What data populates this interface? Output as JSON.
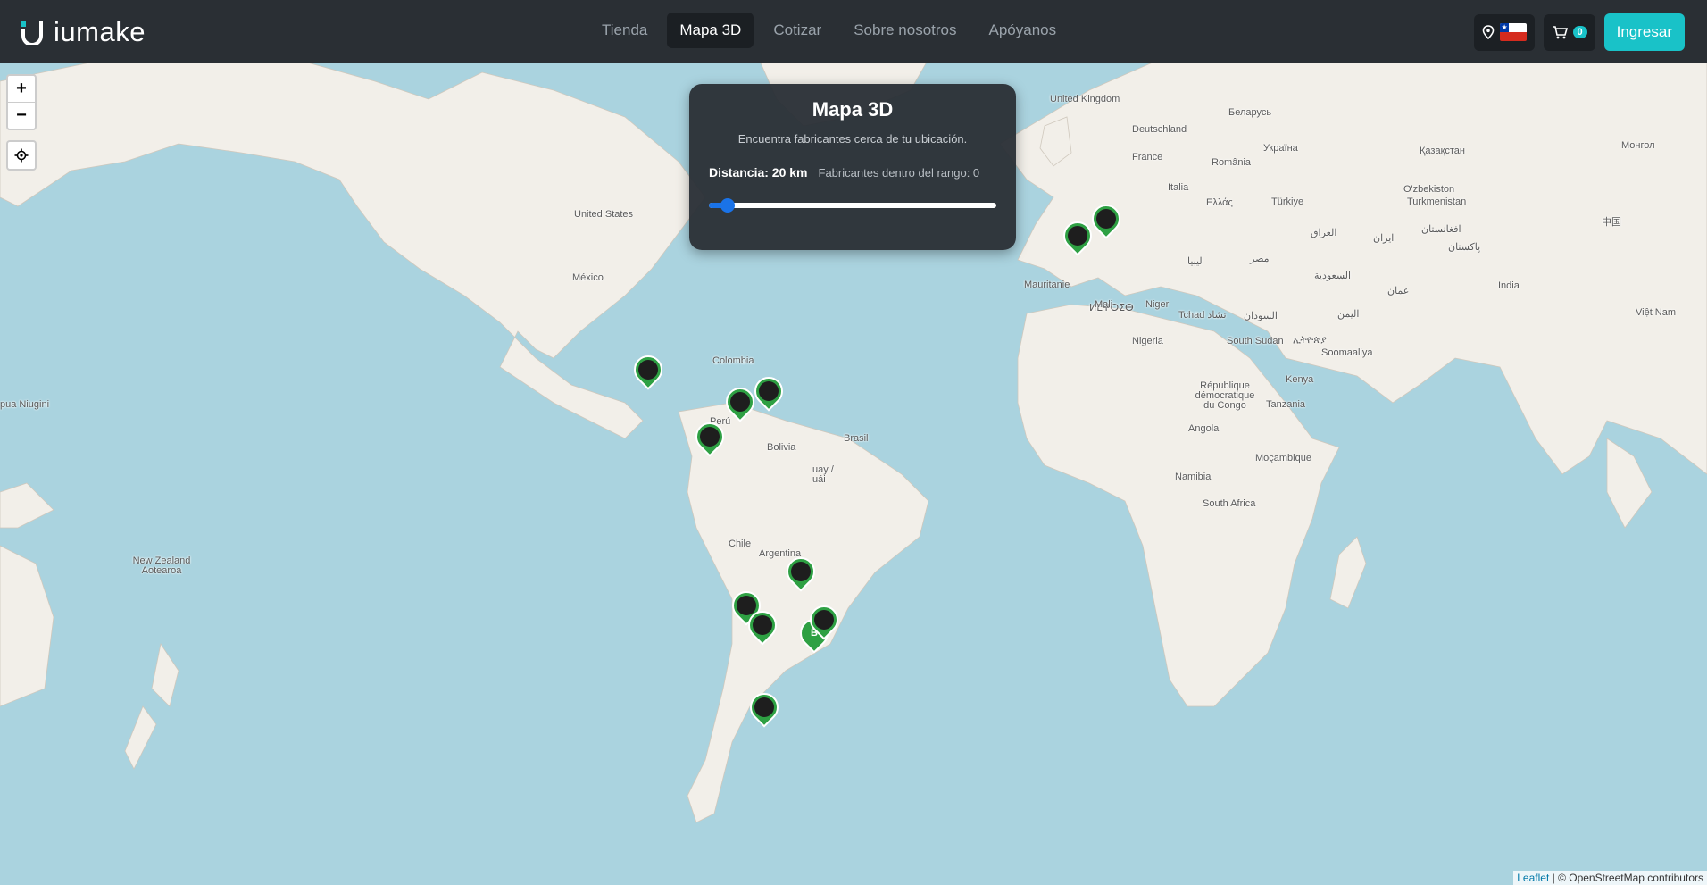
{
  "header": {
    "logo_text": "iumake",
    "nav": [
      "Tienda",
      "Mapa 3D",
      "Cotizar",
      "Sobre nosotros",
      "Apóyanos"
    ],
    "active_nav": "Mapa 3D",
    "cart_count": "0",
    "login_label": "Ingresar",
    "icons": {
      "location": "location-pin-icon",
      "flag": "chile-flag-icon",
      "cart": "cart-icon"
    },
    "brand_color": "#19c2c8"
  },
  "zoom": {
    "in": "+",
    "out": "−"
  },
  "panel": {
    "title": "Mapa 3D",
    "subtitle": "Encuentra fabricantes cerca de tu ubicación.",
    "distance_label": "Distancia: 20 km",
    "range_text": "Fabricantes dentro del rango: 0",
    "slider_fraction": 0.03
  },
  "map_labels": {
    "united_kingdom": "United Kingdom",
    "belarus": "Беларусь",
    "deutschland": "Deutschland",
    "ukraina": "Україна",
    "kazakhstan": "Қазақстан",
    "mongolia": "Монгол",
    "france": "France",
    "romania": "România",
    "italia": "Italia",
    "uzbekistan": "O'zbekiston",
    "ellas": "Ελλάς",
    "turkiye": "Türkiye",
    "turkmenistan": "Turkmenistan",
    "china": "中国",
    "iraq": "العراق",
    "iran": "ایران",
    "afghanistan": "افغانستان",
    "pakistan": "پاکستان",
    "united_states": "United States",
    "morocco": "ⵍⵎⵖⵔⵉⴱ",
    "libya": "ليبيا",
    "egypt": "مصر",
    "saudi": "السعودية",
    "oman": "عمان",
    "india": "India",
    "mexico": "México",
    "mauritanie": "Mauritanie",
    "mali": "Mali",
    "niger": "Niger",
    "tchad": "Tchad تشاد",
    "sudan": "السودان",
    "yemen": "اليمن",
    "vietnam": "Việt Nam",
    "colombia": "Colombia",
    "nigeria": "Nigeria",
    "south_sudan": "South Sudan",
    "ethiopia": "ኢትዮጵያ",
    "somalia": "Soomaaliya",
    "kenya": "Kenya",
    "rdc": "République démocratique du Congo",
    "tanzania": "Tanzania",
    "peru": "Perú",
    "bolivia": "Bolivia",
    "brasil": "Brasil",
    "angola": "Angola",
    "mocambique": "Moçambique",
    "namibia": "Namibia",
    "south_africa": "South Africa",
    "chile": "Chile",
    "argentina": "Argentina",
    "paraguay": "uay / uái",
    "papua": "pua Niugini",
    "new_zealand": "New Zealand Aotearoa"
  },
  "markers": [
    "",
    "",
    "",
    "",
    "",
    "",
    "",
    "",
    "",
    "B",
    "",
    ""
  ],
  "attribution": {
    "leaflet": "Leaflet",
    "rest": " | © OpenStreetMap contributors"
  }
}
